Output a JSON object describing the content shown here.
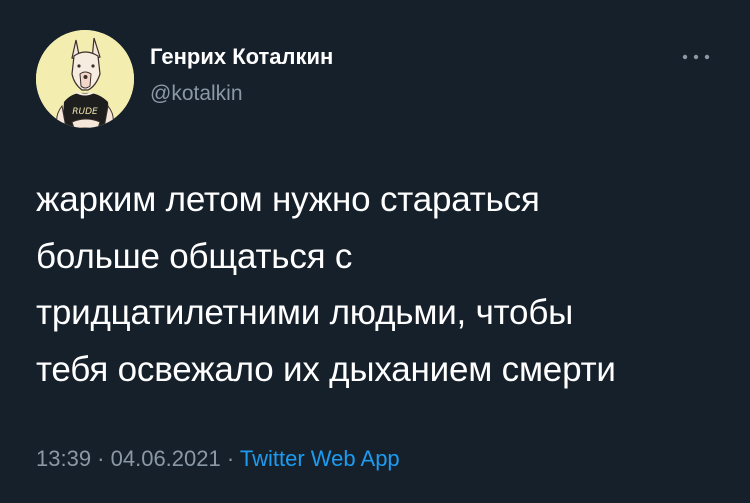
{
  "author": {
    "display_name": "Генрих Коталкин",
    "handle": "@kotalkin",
    "avatar_shirt_text": "RUDE"
  },
  "more_icon": "more-horizontal-icon",
  "tweet": {
    "lines": [
      "жарким летом нужно стараться",
      "больше общаться с",
      "тридцатилетними людьми, чтобы",
      "тебя освежало их дыханием смерти"
    ]
  },
  "meta": {
    "time": "13:39",
    "separator_1": " · ",
    "date": "04.06.2021",
    "separator_2": " · ",
    "source": "Twitter Web App"
  },
  "colors": {
    "background": "#15202b",
    "text_primary": "#ffffff",
    "text_secondary": "#8b98a5",
    "link": "#1d9bf0",
    "avatar_bg": "#f3eeb0"
  }
}
